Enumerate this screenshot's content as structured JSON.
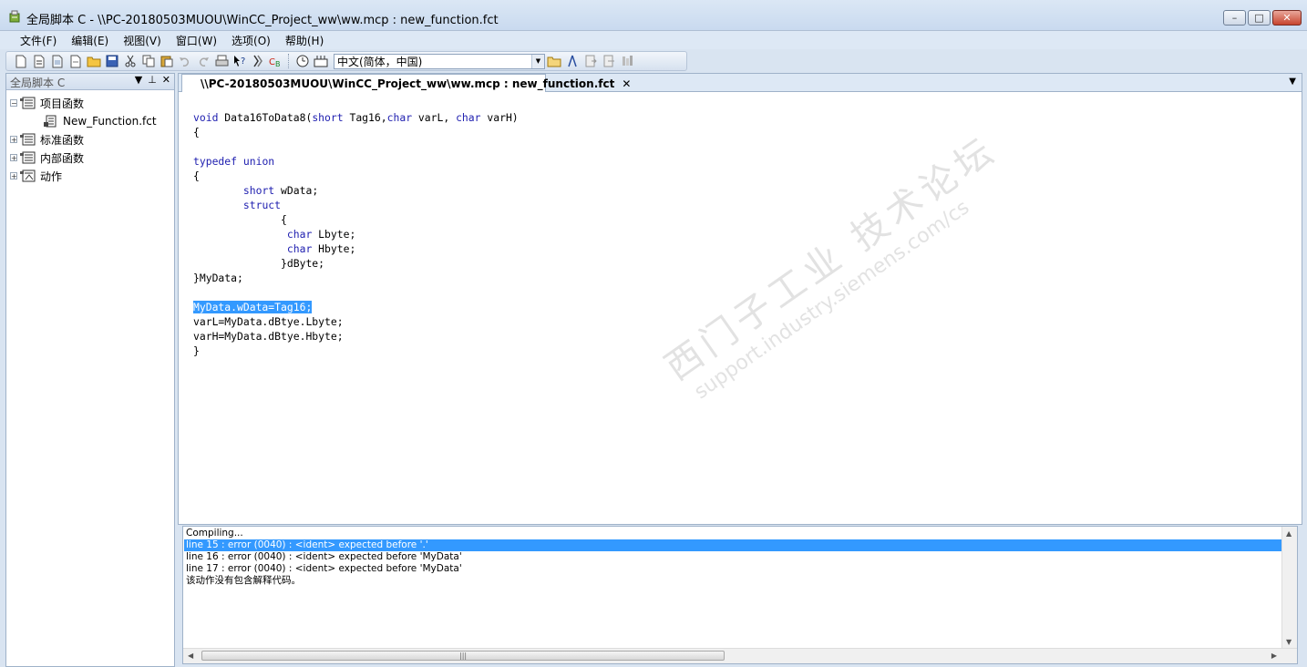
{
  "window": {
    "title": "全局脚本 C - \\\\PC-20180503MUOU\\WinCC_Project_ww\\ww.mcp : new_function.fct",
    "minimize": "–",
    "maximize": "□",
    "close": "✕"
  },
  "menu": {
    "items": [
      {
        "label": "文件(F)"
      },
      {
        "label": "编辑(E)"
      },
      {
        "label": "视图(V)"
      },
      {
        "label": "窗口(W)"
      },
      {
        "label": "选项(O)"
      },
      {
        "label": "帮助(H)"
      }
    ]
  },
  "toolbar": {
    "language_combo": "中文(简体，中国)"
  },
  "left_panel": {
    "title": "全局脚本 C",
    "tree": [
      {
        "label": "项目函数",
        "expander": "−"
      },
      {
        "label": "New_Function.fct"
      },
      {
        "label": "标准函数",
        "expander": "+"
      },
      {
        "label": "内部函数",
        "expander": "+"
      },
      {
        "label": "动作",
        "expander": "+"
      }
    ]
  },
  "editor": {
    "tab_title": "\\\\PC-20180503MUOU\\WinCC_Project_ww\\ww.mcp : new_function.fct",
    "tab_close": "✕",
    "code_lines": [
      "void Data16ToData8(short Tag16,char varL, char varH)",
      "{",
      "",
      "typedef union",
      "{",
      "        short wData;",
      "        struct",
      "              {",
      "               char Lbyte;",
      "               char Hbyte;",
      "              }dByte;",
      "}MyData;",
      "",
      "MyData.wData=Tag16;",
      "varL=MyData.dBtye.Lbyte;",
      "varH=MyData.dBtye.Hbyte;",
      "}"
    ],
    "highlighted_line": 13,
    "watermark_cn": "西门子工业 技术论坛",
    "watermark_url": "support.industry.siemens.com/cs"
  },
  "output": {
    "lines": [
      "Compiling...",
      "line 15 : error (0040) : <ident> expected before '.'",
      "line 16 : error (0040) : <ident> expected before 'MyData'",
      "line 17 : error (0040) : <ident> expected before 'MyData'",
      "该动作没有包含解释代码。"
    ],
    "selected_line": 1,
    "scroll_grip": "|||"
  },
  "colors": {
    "selection": "#3399ff",
    "keyword": "#2020b0",
    "chrome": "#dde8f5"
  }
}
